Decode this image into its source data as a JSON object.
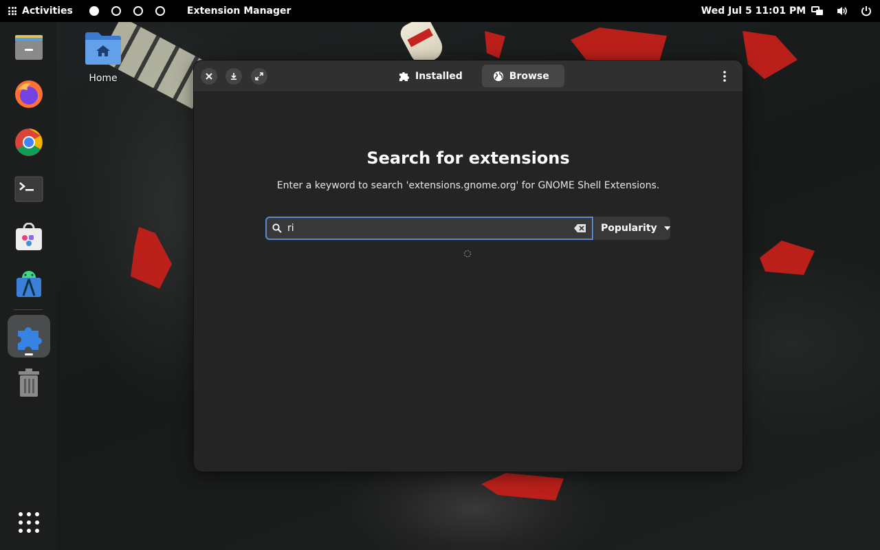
{
  "topbar": {
    "activities_label": "Activities",
    "app_name": "Extension Manager",
    "clock": "Wed Jul 5  11:01 PM"
  },
  "dock": {
    "items": [
      "Files",
      "Firefox",
      "Google Chrome",
      "Terminal",
      "Software",
      "Android Studio",
      "Extension Manager",
      "Trash",
      "Show Applications"
    ],
    "active": "Extension Manager"
  },
  "desktop": {
    "home_label": "Home"
  },
  "window": {
    "tabs": [
      {
        "label": "Installed",
        "icon": "puzzle-icon"
      },
      {
        "label": "Browse",
        "icon": "globe-icon"
      }
    ],
    "active_tab": "Browse",
    "title": "Search for extensions",
    "subtitle": "Enter a keyword to search 'extensions.gnome.org' for GNOME Shell Extensions.",
    "search": {
      "value": "ri",
      "placeholder": ""
    },
    "sort": {
      "selected": "Popularity"
    }
  },
  "colors": {
    "accent": "#5c8ccf",
    "window_bg": "#242424",
    "headerbar_bg": "#303030"
  }
}
